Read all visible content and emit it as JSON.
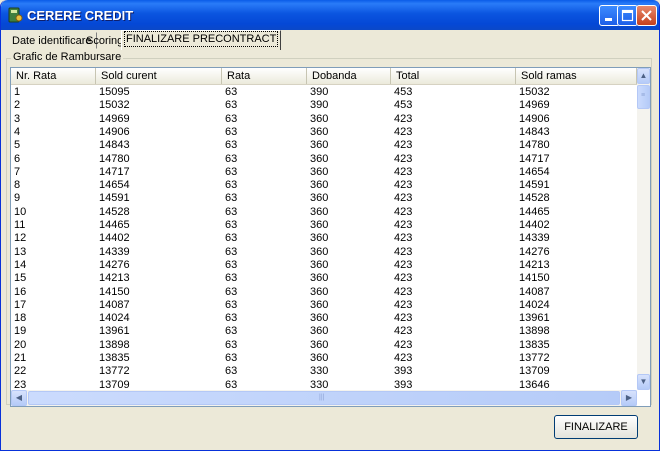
{
  "window": {
    "title": "CERERE CREDIT"
  },
  "tabs": [
    {
      "label": "Date identificare"
    },
    {
      "label": "Scoring"
    },
    {
      "label": "FINALIZARE PRECONTRACT"
    }
  ],
  "group": {
    "title": "Grafic de Rambursare"
  },
  "table": {
    "columns": [
      "Nr. Rata",
      "Sold curent",
      "Rata",
      "Dobanda",
      "Total",
      "Sold ramas"
    ],
    "rows": [
      [
        "1",
        "15095",
        "63",
        "390",
        "453",
        "15032"
      ],
      [
        "2",
        "15032",
        "63",
        "390",
        "453",
        "14969"
      ],
      [
        "3",
        "14969",
        "63",
        "360",
        "423",
        "14906"
      ],
      [
        "4",
        "14906",
        "63",
        "360",
        "423",
        "14843"
      ],
      [
        "5",
        "14843",
        "63",
        "360",
        "423",
        "14780"
      ],
      [
        "6",
        "14780",
        "63",
        "360",
        "423",
        "14717"
      ],
      [
        "7",
        "14717",
        "63",
        "360",
        "423",
        "14654"
      ],
      [
        "8",
        "14654",
        "63",
        "360",
        "423",
        "14591"
      ],
      [
        "9",
        "14591",
        "63",
        "360",
        "423",
        "14528"
      ],
      [
        "10",
        "14528",
        "63",
        "360",
        "423",
        "14465"
      ],
      [
        "11",
        "14465",
        "63",
        "360",
        "423",
        "14402"
      ],
      [
        "12",
        "14402",
        "63",
        "360",
        "423",
        "14339"
      ],
      [
        "13",
        "14339",
        "63",
        "360",
        "423",
        "14276"
      ],
      [
        "14",
        "14276",
        "63",
        "360",
        "423",
        "14213"
      ],
      [
        "15",
        "14213",
        "63",
        "360",
        "423",
        "14150"
      ],
      [
        "16",
        "14150",
        "63",
        "360",
        "423",
        "14087"
      ],
      [
        "17",
        "14087",
        "63",
        "360",
        "423",
        "14024"
      ],
      [
        "18",
        "14024",
        "63",
        "360",
        "423",
        "13961"
      ],
      [
        "19",
        "13961",
        "63",
        "360",
        "423",
        "13898"
      ],
      [
        "20",
        "13898",
        "63",
        "360",
        "423",
        "13835"
      ],
      [
        "21",
        "13835",
        "63",
        "360",
        "423",
        "13772"
      ],
      [
        "22",
        "13772",
        "63",
        "330",
        "393",
        "13709"
      ],
      [
        "23",
        "13709",
        "63",
        "330",
        "393",
        "13646"
      ]
    ]
  },
  "buttons": {
    "finalize": "FINALIZARE"
  },
  "icons": {
    "app": "app-icon",
    "minimize": "minimize-icon",
    "maximize": "maximize-icon",
    "close": "close-icon",
    "scroll_up": "arrow-up-icon",
    "scroll_down": "arrow-down-icon",
    "scroll_left": "arrow-left-icon",
    "scroll_right": "arrow-right-icon"
  },
  "colors": {
    "titlebar": "#0B55E0",
    "window_bg": "#ECE9D8",
    "close_button": "#C5401E"
  }
}
